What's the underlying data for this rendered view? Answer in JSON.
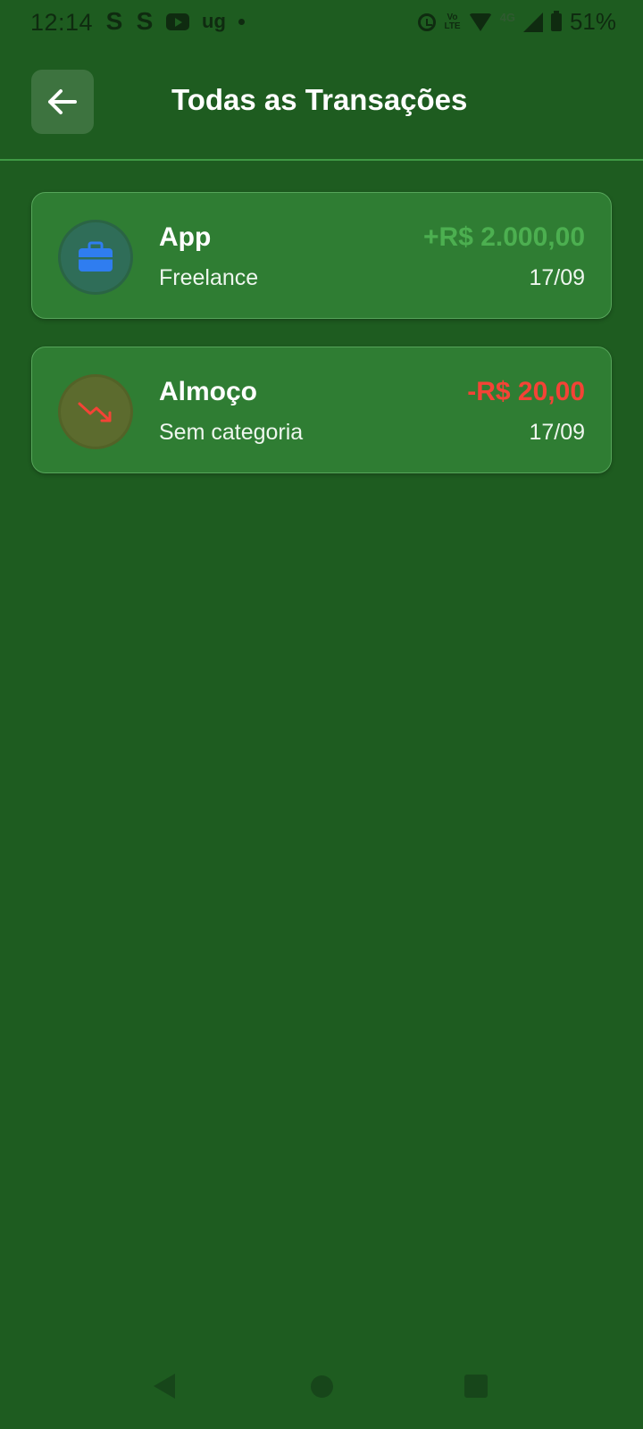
{
  "status_bar": {
    "time": "12:14",
    "left_icons": [
      "S",
      "S",
      "youtube-icon",
      "ug",
      "dot"
    ],
    "s1": "S",
    "s2": "S",
    "ug": "ug",
    "volte_top": "Vo",
    "volte_bottom": "LTE",
    "network": "4G",
    "battery": "51%"
  },
  "header": {
    "title": "Todas as Transações"
  },
  "transactions": [
    {
      "title": "App",
      "category": "Freelance",
      "amount": "+R$ 2.000,00",
      "date": "17/09",
      "type": "income",
      "icon": "briefcase-icon",
      "amount_color": "#4caf50"
    },
    {
      "title": "Almoço",
      "category": "Sem categoria",
      "amount": "-R$ 20,00",
      "date": "17/09",
      "type": "expense",
      "icon": "trending-down-icon",
      "amount_color": "#f44336"
    }
  ],
  "colors": {
    "background": "#1e5c20",
    "card": "#2f7d33",
    "income": "#4caf50",
    "expense": "#f44336"
  }
}
